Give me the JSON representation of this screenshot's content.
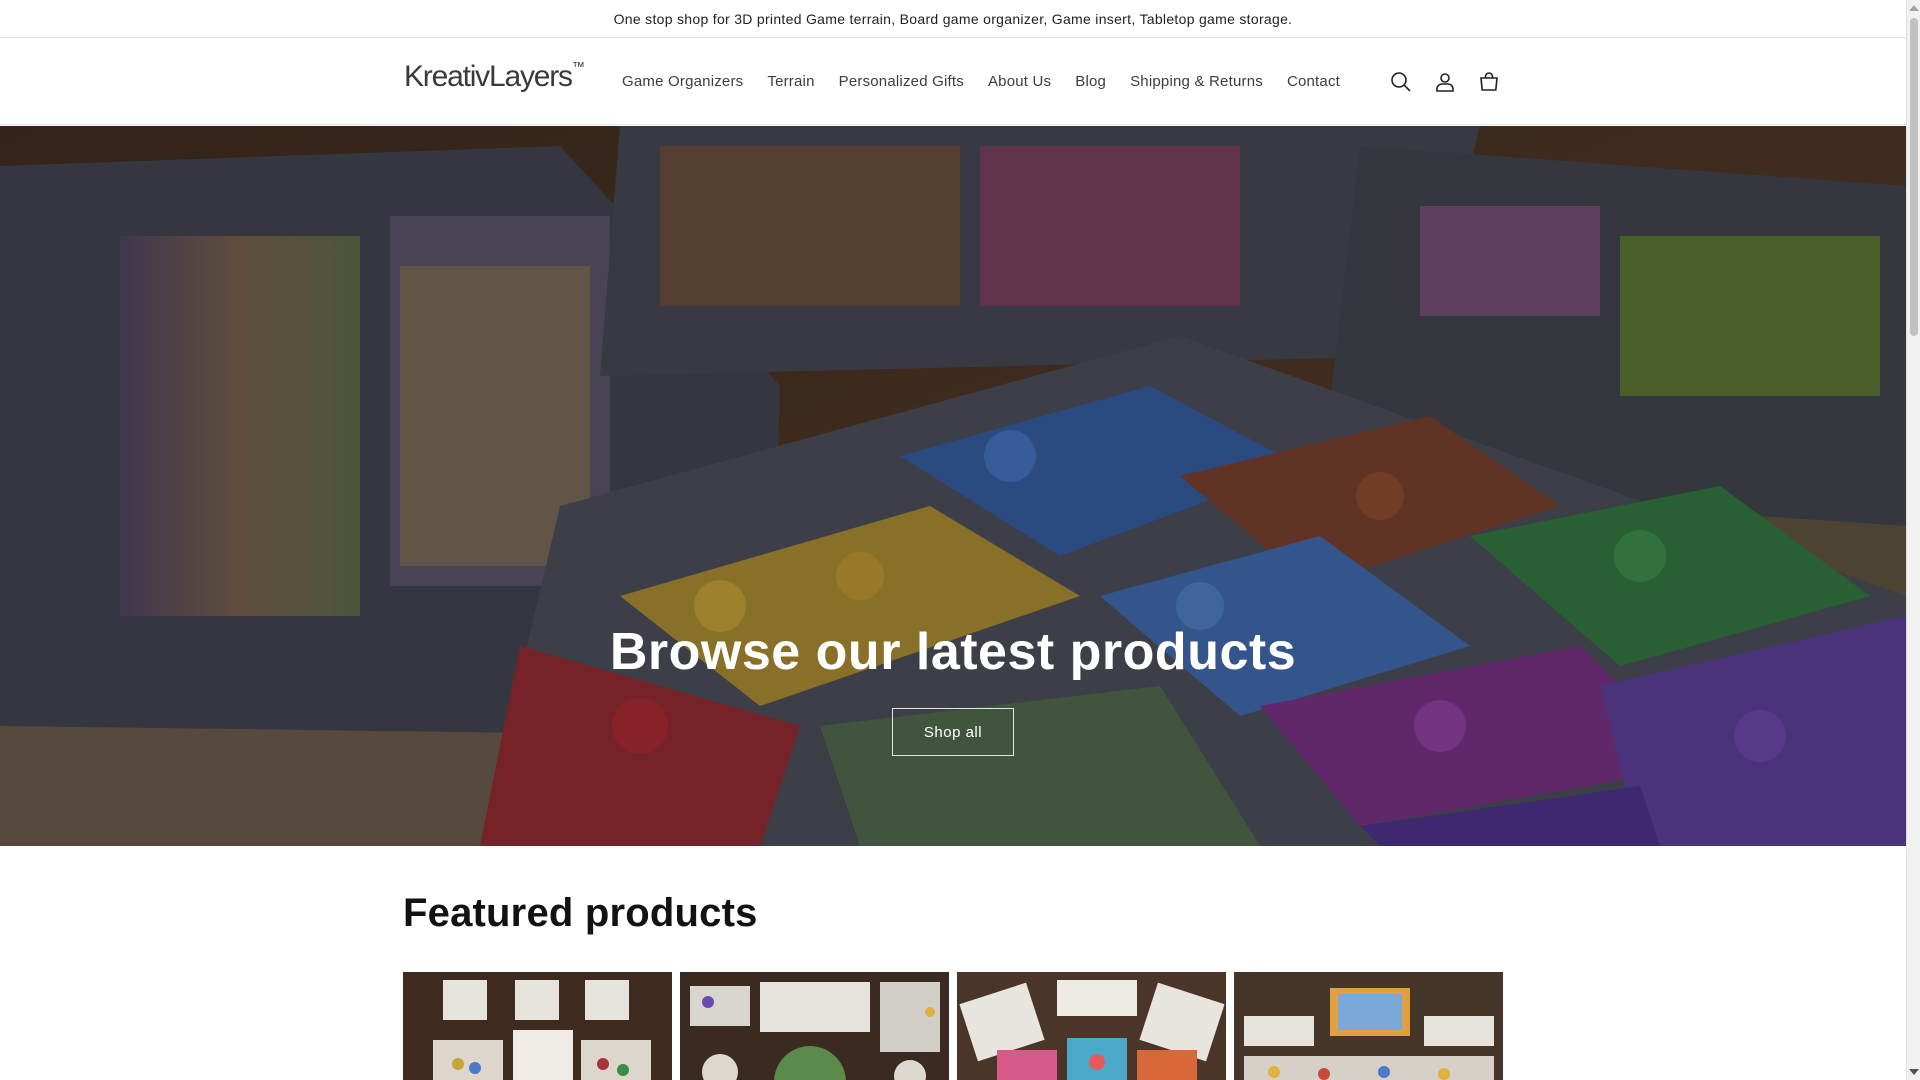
{
  "announcement": "One stop shop for 3D printed Game terrain, Board game organizer, Game insert, Tabletop game storage.",
  "brand": {
    "name": "KreativLayers",
    "mark": "™"
  },
  "nav": {
    "items": [
      {
        "label": "Game Organizers"
      },
      {
        "label": "Terrain"
      },
      {
        "label": "Personalized Gifts"
      },
      {
        "label": "About Us"
      },
      {
        "label": "Blog"
      },
      {
        "label": "Shipping & Returns"
      },
      {
        "label": "Contact"
      }
    ]
  },
  "header_icons": [
    "search-icon",
    "account-icon",
    "cart-icon"
  ],
  "hero": {
    "title": "Browse our latest products",
    "button": "Shop all"
  },
  "featured": {
    "title": "Featured products"
  },
  "colors": {
    "text": "#121212",
    "hero_overlay": "#000000",
    "wood": "#5a3e2b",
    "tray": "#4a4d57"
  }
}
